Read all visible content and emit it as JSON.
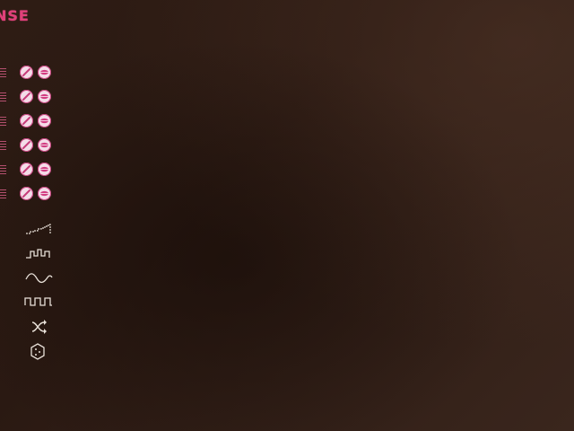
{
  "app": {
    "brand_label": "NSE"
  },
  "colors": {
    "accent": "#e0407a",
    "button_fill": "#f4dce8",
    "icon_stroke": "#e8e0d8"
  },
  "tracks": [
    {
      "menu_icon": "menu-lines-icon",
      "mute_icon": "mute-slash-icon",
      "option_icon": "lips-icon"
    },
    {
      "menu_icon": "menu-lines-icon",
      "mute_icon": "mute-slash-icon",
      "option_icon": "lips-icon"
    },
    {
      "menu_icon": "menu-lines-icon",
      "mute_icon": "mute-slash-icon",
      "option_icon": "lips-icon"
    },
    {
      "menu_icon": "menu-lines-icon",
      "mute_icon": "mute-slash-icon",
      "option_icon": "lips-icon"
    },
    {
      "menu_icon": "menu-lines-icon",
      "mute_icon": "mute-slash-icon",
      "option_icon": "lips-icon"
    },
    {
      "menu_icon": "menu-lines-icon",
      "mute_icon": "mute-slash-icon",
      "option_icon": "lips-icon"
    }
  ],
  "pattern_buttons": [
    {
      "icon": "stairs-ascending-icon"
    },
    {
      "icon": "step-pattern-icon"
    },
    {
      "icon": "sine-wave-icon"
    },
    {
      "icon": "square-wave-icon"
    },
    {
      "icon": "shuffle-icon"
    },
    {
      "icon": "dice-icon"
    }
  ]
}
